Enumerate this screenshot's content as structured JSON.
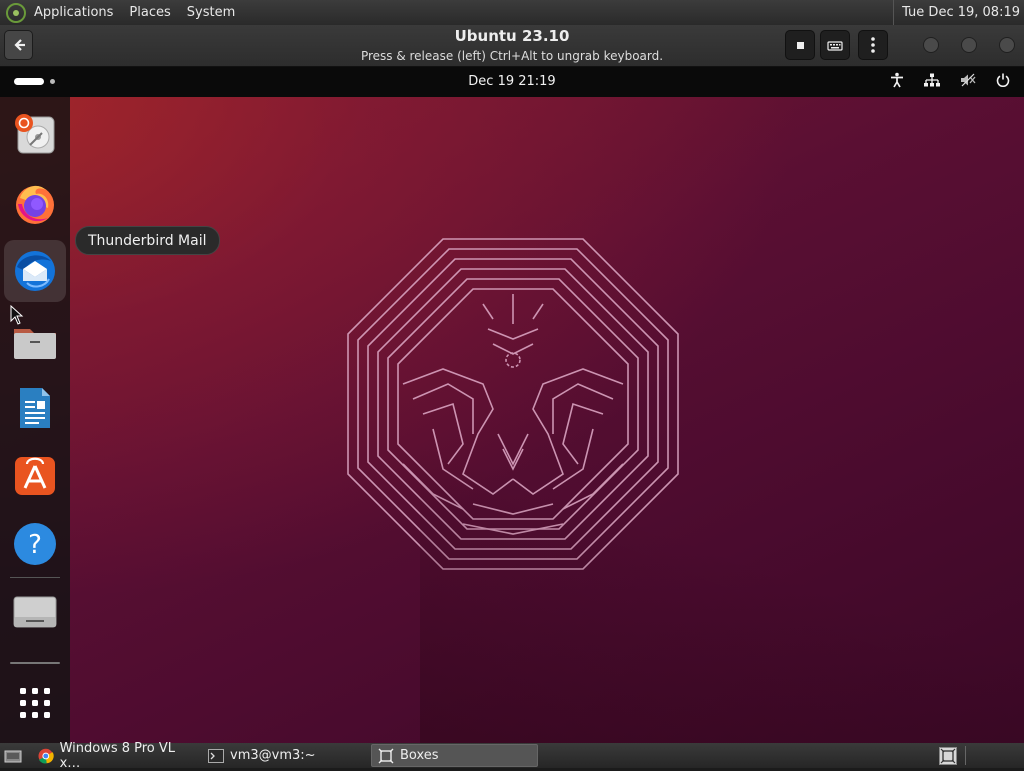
{
  "host_panel": {
    "menus": [
      "Applications",
      "Places",
      "System"
    ],
    "clock": "Tue Dec 19, 08:19"
  },
  "boxes_header": {
    "title": "Ubuntu 23.10",
    "subtitle": "Press & release (left) Ctrl+Alt to ungrab keyboard."
  },
  "guest": {
    "clock": "Dec 19  21:19",
    "tooltip": "Thunderbird Mail",
    "dock_apps": [
      "ubuntu-installer",
      "firefox",
      "thunderbird",
      "files",
      "libreoffice-writer",
      "app-center",
      "help",
      "drive",
      "show-apps"
    ]
  },
  "taskbar": {
    "tasks": [
      {
        "label": "Windows 8 Pro VL x…",
        "icon": "chrome-icon"
      },
      {
        "label": "vm3@vm3:~",
        "icon": "terminal-icon"
      },
      {
        "label": "Boxes",
        "icon": "boxes-icon"
      }
    ]
  },
  "colors": {
    "wallpaper_dark": "#4a0b2e",
    "wallpaper_red": "#aa2828",
    "ubuntu_orange": "#e95420"
  }
}
